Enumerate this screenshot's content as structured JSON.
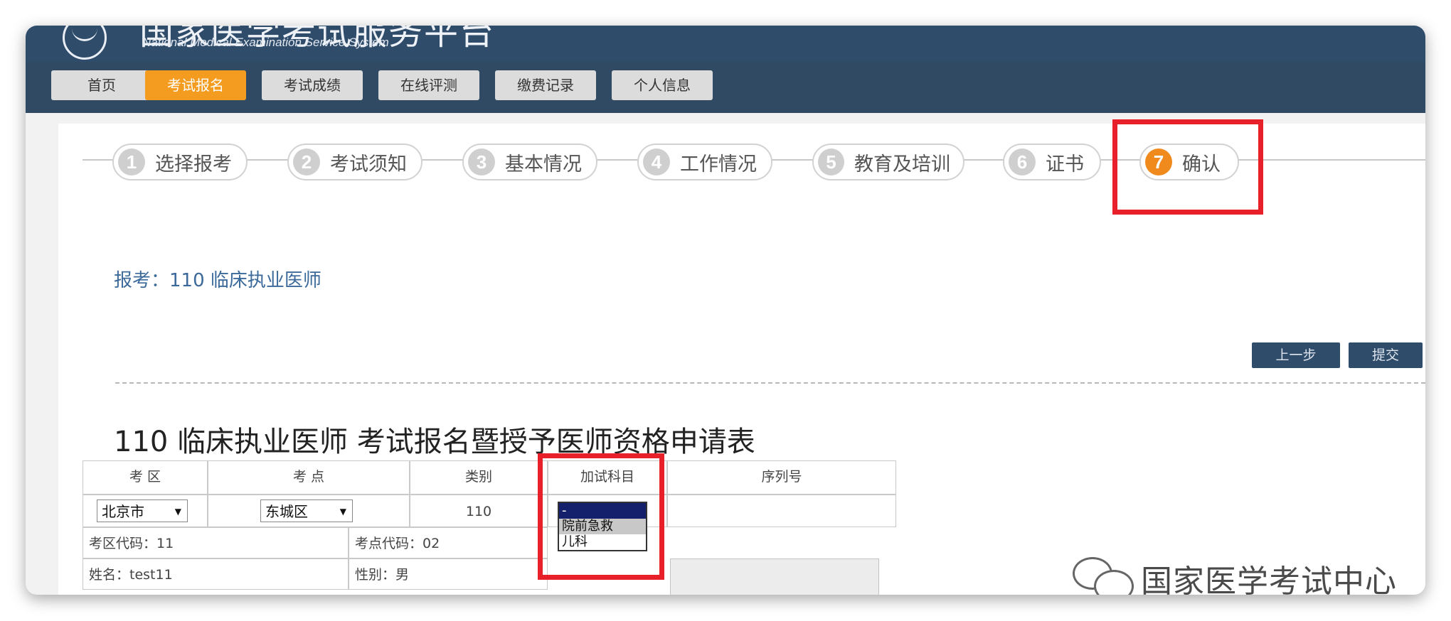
{
  "header": {
    "title_cn": "国家医学考试服务平台",
    "title_en": "National Medical Examination Service System"
  },
  "nav": {
    "items": [
      "首页",
      "考试报名",
      "考试成绩",
      "在线评测",
      "缴费记录",
      "个人信息"
    ],
    "active": "考试报名"
  },
  "steps": [
    {
      "num": "1",
      "label": "选择报考"
    },
    {
      "num": "2",
      "label": "考试须知"
    },
    {
      "num": "3",
      "label": "基本情况"
    },
    {
      "num": "4",
      "label": "工作情况"
    },
    {
      "num": "5",
      "label": "教育及培训"
    },
    {
      "num": "6",
      "label": "证书"
    },
    {
      "num": "7",
      "label": "确认"
    }
  ],
  "current_step": "7",
  "baokao": "报考：110 临床执业医师",
  "buttons": {
    "prev": "上一步",
    "submit": "提交"
  },
  "form": {
    "title": "110 临床执业医师 考试报名暨授予医师资格申请表",
    "headers": {
      "kaoqu": "考 区",
      "kaodian": "考 点",
      "leibie": "类别",
      "jiashi": "加试科目",
      "xuliehao": "序列号"
    },
    "kaoqu_value": "北京市",
    "kaodian_value": "东城区",
    "leibie_value": "110",
    "jiashi_options": [
      "-",
      "院前急救",
      "儿科"
    ],
    "kaoqu_code": "考区代码：11",
    "kaodian_code": "考点代码：02",
    "name": "姓名：test11",
    "gender": "性别：男"
  },
  "watermark": "国家医学考试中心",
  "colors": {
    "header": "#2f4c6b",
    "active_nav": "#f39c1f",
    "highlight": "#e8202a",
    "step_current": "#f08a1c"
  }
}
